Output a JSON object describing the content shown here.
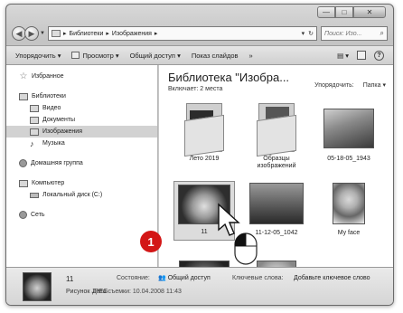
{
  "window": {
    "caption_buttons": {
      "minimize": "—",
      "maximize": "□",
      "close": "✕"
    }
  },
  "address_bar": {
    "path": [
      "Библиотеки",
      "Изображения"
    ],
    "separator": "▸",
    "refresh_icon": "↻",
    "search_placeholder": "Поиск: Изо..."
  },
  "toolbar": {
    "organize": "Упорядочить ▾",
    "preview": "Просмотр ▾",
    "share": "Общий доступ ▾",
    "slideshow": "Показ слайдов",
    "more": "»",
    "view_icon": "▤ ▾",
    "help": "?"
  },
  "navpane": {
    "favorites": "Избранное",
    "libraries": "Библиотеки",
    "library_items": [
      "Видео",
      "Документы",
      "Изображения",
      "Музыка"
    ],
    "homegroup": "Домашняя группа",
    "computer": "Компьютер",
    "local_disk": "Локальный диск (C:)",
    "network": "Сеть"
  },
  "content": {
    "title": "Библиотека \"Изобра...",
    "includes_label": "Включает:",
    "includes_value": "2 места",
    "arrange_label": "Упорядочить:",
    "arrange_value": "Папка ▾",
    "tiles": [
      {
        "label": "Лето 2019"
      },
      {
        "label": "Образцы изображений"
      },
      {
        "label": "05-18-05_1943"
      },
      {
        "label": "11"
      },
      {
        "label": "11-12-05_1042"
      },
      {
        "label": "My face"
      }
    ]
  },
  "badge": "1",
  "details": {
    "name": "11",
    "type": "Рисунок JPEG",
    "state_label": "Состояние:",
    "state_value": "Общий доступ",
    "date_label": "Дата съемки:",
    "date_value": "10.04.2008 11:43",
    "keywords_label": "Ключевые слова:",
    "keywords_value": "Добавьте ключевое слово"
  }
}
